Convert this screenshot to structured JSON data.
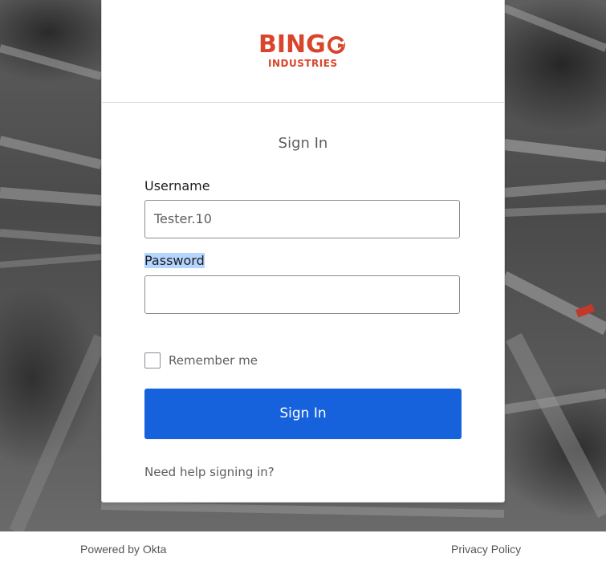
{
  "logo": {
    "brand_top": "BINGO",
    "brand_top_prefix": "BING",
    "brand_sub": "INDUSTRIES",
    "brand_color": "#d9452b"
  },
  "form": {
    "title": "Sign In",
    "username_label": "Username",
    "username_value": "Tester.10",
    "password_label": "Password",
    "password_value": "",
    "remember_label": "Remember me",
    "remember_checked": false,
    "submit_label": "Sign In",
    "help_link": "Need help signing in?",
    "accent_color": "#1662dd"
  },
  "footer": {
    "powered_by": "Powered by Okta",
    "privacy": "Privacy Policy"
  }
}
